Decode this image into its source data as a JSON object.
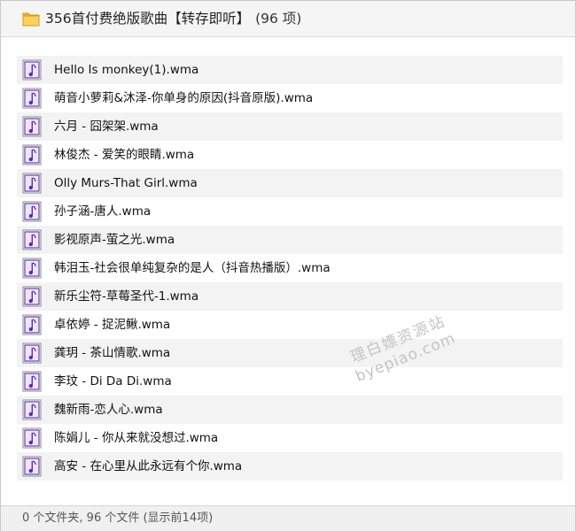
{
  "window": {
    "title": "356首付费绝版歌曲【转存即听】",
    "count": "(96 项)"
  },
  "files": [
    {
      "name": "Hello Is monkey(1).wma",
      "icon": "audio-file-icon"
    },
    {
      "name": "萌音小萝莉&沐泽-你单身的原因(抖音原版).wma",
      "icon": "audio-file-icon"
    },
    {
      "name": "六月 - 囧架架.wma",
      "icon": "audio-file-icon"
    },
    {
      "name": "林俊杰 - 爱笑的眼睛.wma",
      "icon": "audio-file-icon"
    },
    {
      "name": "Olly Murs-That Girl.wma",
      "icon": "audio-file-icon"
    },
    {
      "name": "孙子涵-唐人.wma",
      "icon": "audio-file-icon"
    },
    {
      "name": "影视原声-萤之光.wma",
      "icon": "audio-file-icon"
    },
    {
      "name": "韩泪玉-社会很单纯复杂的是人（抖音热播版）.wma",
      "icon": "audio-file-icon"
    },
    {
      "name": "新乐尘符-草莓圣代-1.wma",
      "icon": "audio-file-icon"
    },
    {
      "name": "卓依婷 - 捉泥鳅.wma",
      "icon": "audio-file-icon"
    },
    {
      "name": "龚玥 - 茶山情歌.wma",
      "icon": "audio-file-icon"
    },
    {
      "name": "李玟 - Di Da Di.wma",
      "icon": "audio-file-icon"
    },
    {
      "name": "魏新雨-恋人心.wma",
      "icon": "audio-file-icon"
    },
    {
      "name": "陈娟儿 - 你从来就没想过.wma",
      "icon": "audio-file-icon"
    },
    {
      "name": "高安 - 在心里从此永远有个你.wma",
      "icon": "audio-file-icon"
    }
  ],
  "watermark": {
    "line1": "理白嫖资源站",
    "line2": "byepiao.com"
  },
  "status": {
    "text": "0 个文件夹, 96 个文件 (显示前14项)"
  },
  "colors": {
    "folder": "#f7c64a",
    "audio_icon": "#6a3fb5",
    "row_alt": "#f3f3f3"
  }
}
